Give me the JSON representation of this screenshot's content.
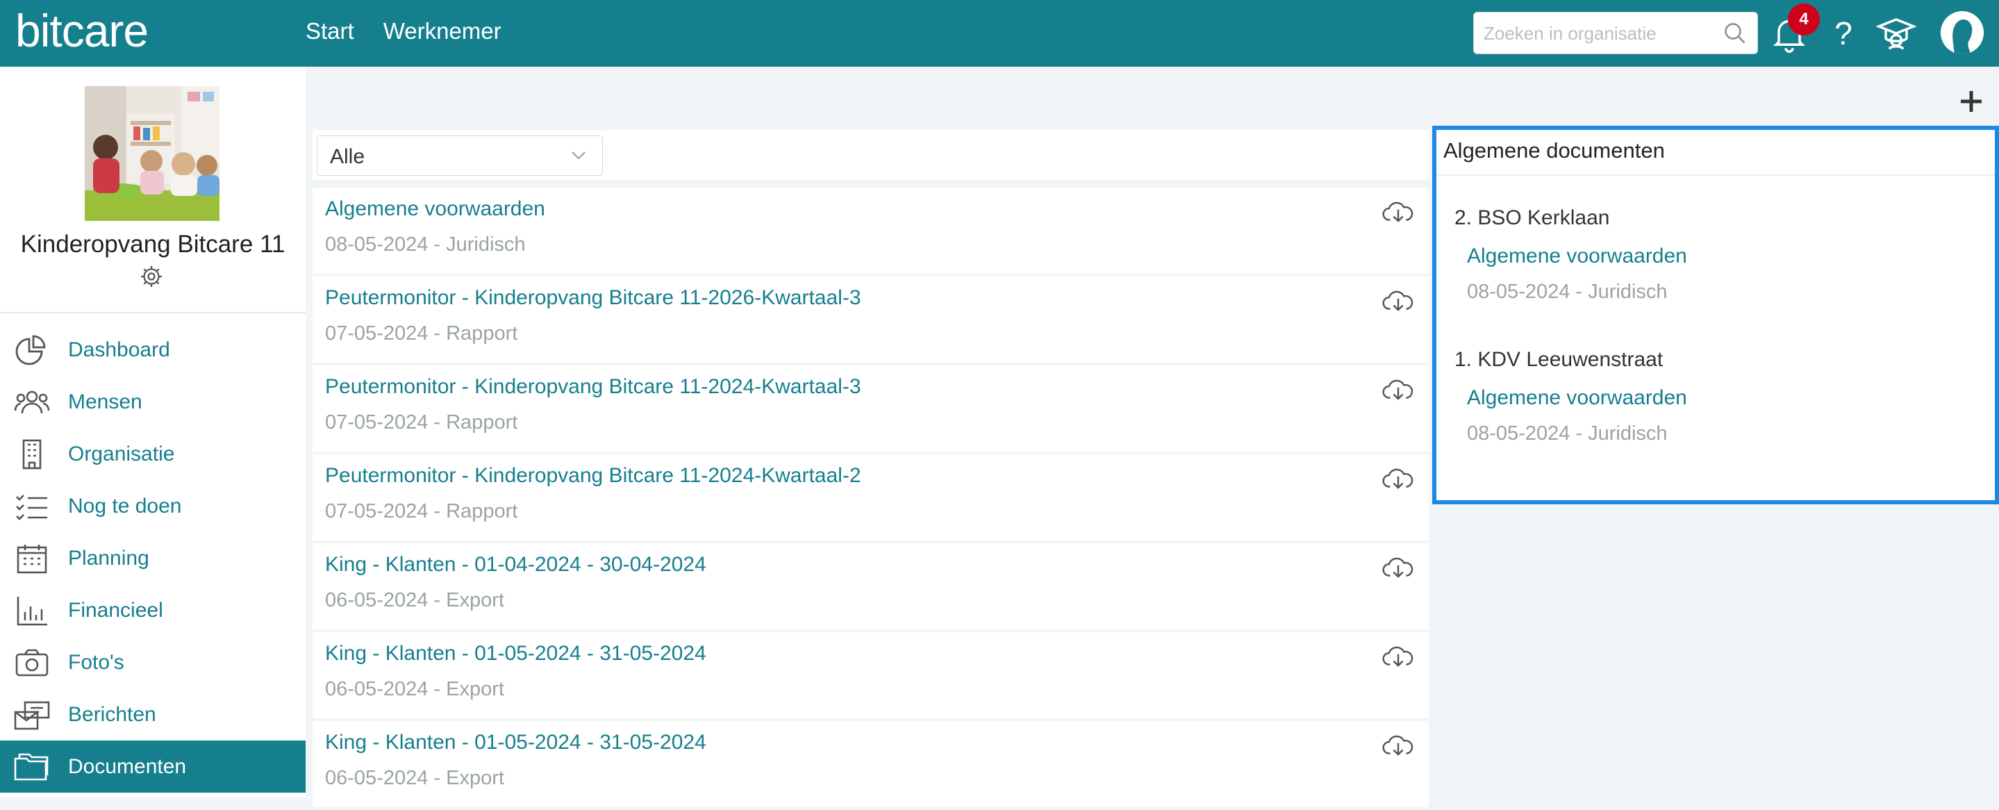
{
  "header": {
    "logo": "bitcare",
    "nav": [
      "Start",
      "Werknemer"
    ],
    "search_placeholder": "Zoeken in organisatie",
    "notifications_count": "4",
    "help_label": "?"
  },
  "sidebar": {
    "org_name": "Kinderopvang Bitcare 11",
    "items": [
      {
        "label": "Dashboard",
        "icon": "pie-chart-icon",
        "active": false
      },
      {
        "label": "Mensen",
        "icon": "people-icon",
        "active": false
      },
      {
        "label": "Organisatie",
        "icon": "building-icon",
        "active": false
      },
      {
        "label": "Nog te doen",
        "icon": "checklist-icon",
        "active": false
      },
      {
        "label": "Planning",
        "icon": "calendar-icon",
        "active": false
      },
      {
        "label": "Financieel",
        "icon": "bar-chart-icon",
        "active": false
      },
      {
        "label": "Foto's",
        "icon": "camera-icon",
        "active": false
      },
      {
        "label": "Berichten",
        "icon": "messages-icon",
        "active": false
      },
      {
        "label": "Documenten",
        "icon": "folder-icon",
        "active": true
      }
    ]
  },
  "filter": {
    "selected": "Alle"
  },
  "documents": [
    {
      "title": "Algemene voorwaarden",
      "meta": "08-05-2024 - Juridisch"
    },
    {
      "title": "Peutermonitor - Kinderopvang Bitcare 11-2026-Kwartaal-3",
      "meta": "07-05-2024 - Rapport"
    },
    {
      "title": "Peutermonitor - Kinderopvang Bitcare 11-2024-Kwartaal-3",
      "meta": "07-05-2024 - Rapport"
    },
    {
      "title": "Peutermonitor - Kinderopvang Bitcare 11-2024-Kwartaal-2",
      "meta": "07-05-2024 - Rapport"
    },
    {
      "title": "King - Klanten - 01-04-2024 - 30-04-2024",
      "meta": "06-05-2024 - Export"
    },
    {
      "title": "King - Klanten - 01-05-2024 - 31-05-2024",
      "meta": "06-05-2024 - Export"
    },
    {
      "title": "King - Klanten - 01-05-2024 - 31-05-2024",
      "meta": "06-05-2024 - Export"
    }
  ],
  "panel": {
    "title": "Algemene documenten",
    "groups": [
      {
        "name": "2. BSO Kerklaan",
        "link": "Algemene voorwaarden",
        "meta": "08-05-2024 - Juridisch"
      },
      {
        "name": "1. KDV Leeuwenstraat",
        "link": "Algemene voorwaarden",
        "meta": "08-05-2024 - Juridisch"
      }
    ]
  },
  "colors": {
    "primary": "#157f8e",
    "badge": "#d0021b",
    "highlight": "#1e88e5",
    "muted": "#9aa3a8"
  }
}
